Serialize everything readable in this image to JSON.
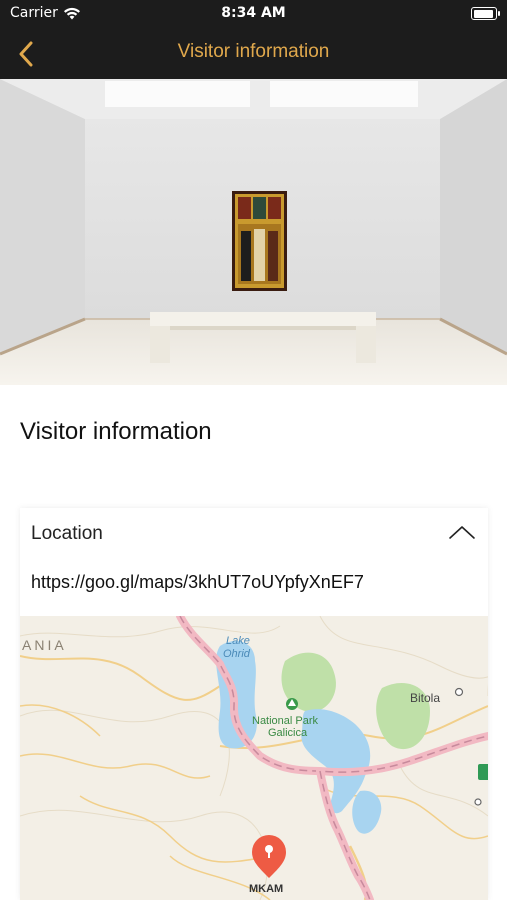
{
  "status_bar": {
    "carrier": "Carrier",
    "time": "8:34 AM",
    "wifi_icon": "wifi-icon",
    "battery_icon": "battery-icon",
    "battery_level": 0.95
  },
  "nav": {
    "title": "Visitor information",
    "back_icon": "chevron-left-icon",
    "accent_color": "#e0a84c",
    "bar_color": "#1c1c1c"
  },
  "hero": {
    "description_icon": "gallery-photo"
  },
  "page": {
    "heading": "Visitor information"
  },
  "location_card": {
    "title": "Location",
    "toggle_icon": "chevron-up-icon",
    "link": "https://goo.gl/maps/3khUT7oUYpfyXnEF7",
    "map": {
      "labels": {
        "region": "ANIA",
        "lake": "Lake Ohrid",
        "lake_line1": "Lake",
        "lake_line2": "Ohrid",
        "park_line1": "National Park",
        "park_line2": "Galicica",
        "city": "Bitola",
        "pin": "MKAM"
      },
      "pin_icon": "map-pin-icon",
      "water_color": "#a8d4f0",
      "park_color": "#bfe0a8"
    }
  }
}
